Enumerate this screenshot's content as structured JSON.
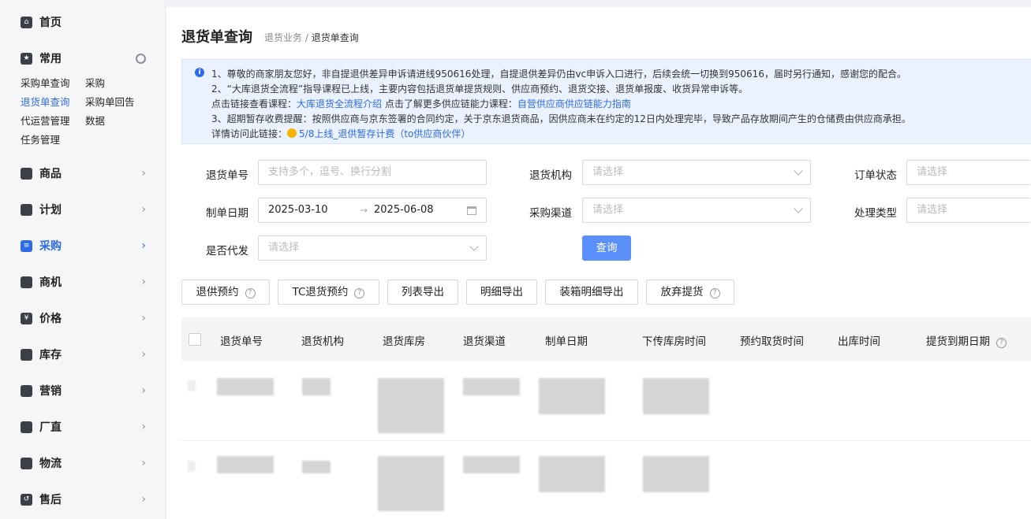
{
  "sidebar": {
    "items": [
      {
        "id": "home",
        "label": "首页",
        "icon": "home-icon"
      },
      {
        "id": "common",
        "label": "常用",
        "icon": "star-icon"
      },
      {
        "id": "goods",
        "label": "商品",
        "icon": "goods-icon"
      },
      {
        "id": "plan",
        "label": "计划",
        "icon": "plan-icon"
      },
      {
        "id": "purchase",
        "label": "采购",
        "icon": "purchase-icon",
        "active": true
      },
      {
        "id": "opportunity",
        "label": "商机",
        "icon": "lightbulb-icon"
      },
      {
        "id": "price",
        "label": "价格",
        "icon": "price-icon"
      },
      {
        "id": "inventory",
        "label": "库存",
        "icon": "inventory-icon"
      },
      {
        "id": "marketing",
        "label": "营销",
        "icon": "chart-icon"
      },
      {
        "id": "direct",
        "label": "厂直",
        "icon": "truck-icon"
      },
      {
        "id": "logistics",
        "label": "物流",
        "icon": "logistics-icon"
      },
      {
        "id": "aftersale",
        "label": "售后",
        "icon": "return-icon"
      }
    ],
    "common_links": [
      "采购单查询",
      "采购",
      "退货单查询",
      "采购单回告",
      "代运营管理",
      "数据",
      "任务管理"
    ]
  },
  "page": {
    "title": "退货单查询",
    "breadcrumb_parent": "退货业务 /",
    "breadcrumb_current": "退货单查询"
  },
  "notice": {
    "line1": "1、尊敬的商家朋友您好，非自提退供差异申诉请进线950616处理，自提退供差异仍由vc申诉入口进行，后续会统一切换到950616，届时另行通知，感谢您的配合。",
    "line2": "2、“大库退货全流程”指导课程已上线，主要内容包括退货单提货规则、供应商预约、退货交接、退货单报废、收货异常申诉等。",
    "line3_prefix": "点击链接查看课程：",
    "line3_link1": "大库退货全流程介绍",
    "line3_mid": "点击了解更多供应链能力课程：",
    "line3_link2": "自营供应商供应链能力指南",
    "line4": "3、超期暂存收费提醒：按照供应商与京东签署的合同约定，关于京东退货商品，因供应商未在约定的12日内处理完毕，导致产品存放期间产生的仓储费由供应商承担。",
    "line5_prefix": "详情访问此链接：",
    "line5_link": "5/8上线_退供暂存计费（to供应商伙伴）"
  },
  "form": {
    "return_no_label": "退货单号",
    "return_no_placeholder": "支持多个，逗号、换行分割",
    "org_label": "退货机构",
    "org_placeholder": "请选择",
    "order_status_label": "订单状态",
    "order_status_placeholder": "请选择",
    "date_label": "制单日期",
    "date_start": "2025-03-10",
    "date_sep": "→",
    "date_end": "2025-06-08",
    "channel_label": "采购渠道",
    "channel_placeholder": "请选择",
    "handle_type_label": "处理类型",
    "handle_type_placeholder": "请选择",
    "dropship_label": "是否代发",
    "dropship_placeholder": "请选择",
    "query_button": "查询"
  },
  "actions": {
    "return_reservation": "退供预约",
    "tc_reservation": "TC退货预约",
    "list_export": "列表导出",
    "detail_export": "明细导出",
    "packing_export": "装箱明细导出",
    "abandon_pickup": "放弃提货"
  },
  "table": {
    "columns": [
      "退货单号",
      "退货机构",
      "退货库房",
      "退货渠道",
      "制单日期",
      "下传库房时间",
      "预约取货时间",
      "出库时间",
      "提货到期日期"
    ]
  }
}
